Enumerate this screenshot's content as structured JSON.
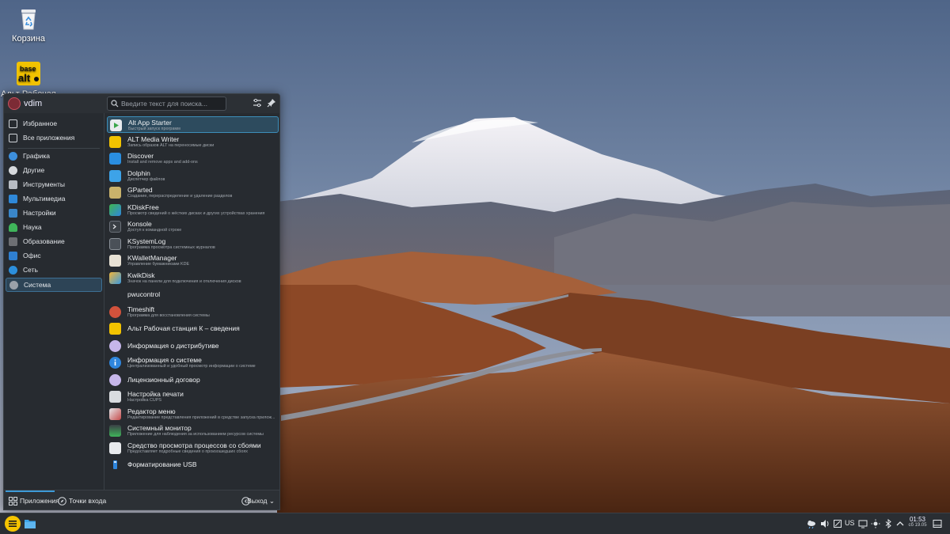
{
  "desktop": {
    "icons": [
      {
        "label": "Корзина",
        "icon": "trash-icon"
      },
      {
        "label": "Альт Рабочая",
        "icon": "alt-base-icon"
      }
    ]
  },
  "launcher": {
    "username": "vdim",
    "search": {
      "placeholder": "Введите текст для поиска...",
      "value": ""
    },
    "categories": [
      {
        "label": "Избранное",
        "icon": "favorites-icon"
      },
      {
        "label": "Все приложения",
        "icon": "all-apps-icon"
      },
      {
        "label": "Графика",
        "icon": "graphics-icon"
      },
      {
        "label": "Другие",
        "icon": "other-icon"
      },
      {
        "label": "Инструменты",
        "icon": "tools-icon"
      },
      {
        "label": "Мультимедиа",
        "icon": "multimedia-icon"
      },
      {
        "label": "Настройки",
        "icon": "settings-icon"
      },
      {
        "label": "Наука",
        "icon": "science-icon"
      },
      {
        "label": "Образование",
        "icon": "education-icon"
      },
      {
        "label": "Офис",
        "icon": "office-icon"
      },
      {
        "label": "Сеть",
        "icon": "network-icon"
      },
      {
        "label": "Система",
        "icon": "system-icon"
      }
    ],
    "selected_category": "Система",
    "apps": [
      {
        "name": "Alt App Starter",
        "desc": "Быстрый запуск программ",
        "icon": "alt-app-starter-icon"
      },
      {
        "name": "ALT Media Writer",
        "desc": "Запись образов ALT на переносимые диски",
        "icon": "media-writer-icon"
      },
      {
        "name": "Discover",
        "desc": "Install and remove apps and add-ons",
        "icon": "discover-icon"
      },
      {
        "name": "Dolphin",
        "desc": "Диспетчер файлов",
        "icon": "dolphin-icon"
      },
      {
        "name": "GParted",
        "desc": "Создание, перераспределение и удаление разделов",
        "icon": "gparted-icon"
      },
      {
        "name": "KDiskFree",
        "desc": "Просмотр сведений о жёстких дисках и других устройствах хранения",
        "icon": "kdiskfree-icon"
      },
      {
        "name": "Konsole",
        "desc": "Доступ к командной строке",
        "icon": "konsole-icon"
      },
      {
        "name": "KSystemLog",
        "desc": "Программа просмотра системных журналов",
        "icon": "ksystemlog-icon"
      },
      {
        "name": "KWalletManager",
        "desc": "Управление бумажниками KDE",
        "icon": "kwallet-icon"
      },
      {
        "name": "KwikDisk",
        "desc": "Значок на панели для подключения и отключения дисков",
        "icon": "kwikdisk-icon"
      },
      {
        "name": "pwucontrol",
        "desc": "",
        "icon": "pwucontrol-icon"
      },
      {
        "name": "Timeshift",
        "desc": "Программа для восстановления системы",
        "icon": "timeshift-icon"
      },
      {
        "name": "Альт Рабочая станция К – сведения",
        "desc": "",
        "icon": "alt-info-icon"
      },
      {
        "name": "Информация о дистрибутиве",
        "desc": "",
        "icon": "distro-info-icon"
      },
      {
        "name": "Информация о системе",
        "desc": "Централизованный и удобный просмотр информации о системе",
        "icon": "system-info-icon"
      },
      {
        "name": "Лицензионный договор",
        "desc": "",
        "icon": "license-icon"
      },
      {
        "name": "Настройка печати",
        "desc": "Настройка CUPS",
        "icon": "printer-icon"
      },
      {
        "name": "Редактор меню",
        "desc": "Редактирование представления приложений в средстве запуска прилож...",
        "icon": "menu-editor-icon"
      },
      {
        "name": "Системный монитор",
        "desc": "Приложение для наблюдения за использованием ресурсов системы",
        "icon": "system-monitor-icon"
      },
      {
        "name": "Средство просмотра процессов со сбоями",
        "desc": "Предоставляет подробные сведения о произошедших сбоях",
        "icon": "crash-viewer-icon"
      },
      {
        "name": "Форматирование USB",
        "desc": "",
        "icon": "usb-format-icon"
      }
    ],
    "bottom": {
      "apps_tab": "Приложения",
      "places_tab": "Точки входа",
      "logout": "Выход"
    }
  },
  "taskbar": {
    "keyboard_layout": "US",
    "time": "01:53",
    "date": "сб 19.05",
    "tray_icons": [
      "weather-icon",
      "volume-icon",
      "notes-icon",
      "screen-icon",
      "network-tray-icon",
      "brightness-icon",
      "bluetooth-icon",
      "expand-tray-icon"
    ]
  },
  "colors": {
    "panel": "#272b30",
    "accent": "#3d9ad8",
    "selection": "#2d4b5e",
    "kmenu": "#f5c400"
  }
}
